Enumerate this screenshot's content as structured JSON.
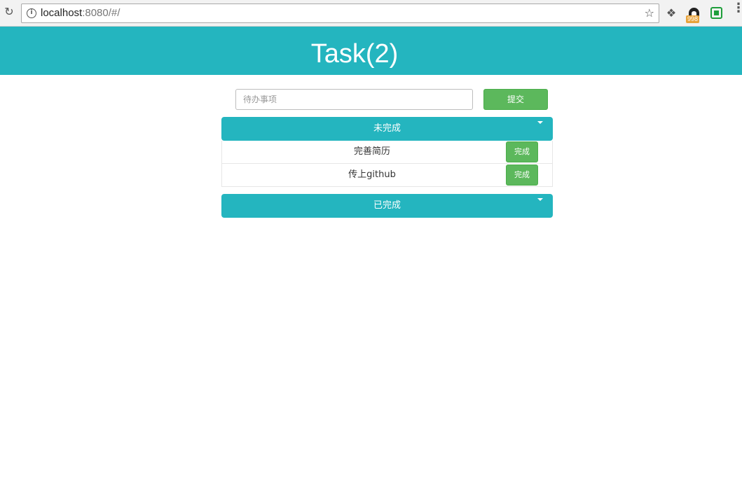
{
  "browser": {
    "url_host": "localhost",
    "url_rest": ":8080/#/",
    "extension_badge": "998"
  },
  "header": {
    "title": "Task(2)"
  },
  "form": {
    "input_placeholder": "待办事项",
    "input_value": "",
    "submit_label": "提交"
  },
  "pending": {
    "title": "未完成",
    "items": [
      {
        "text": "完善简历",
        "action": "完成"
      },
      {
        "text": "传上github",
        "action": "完成"
      }
    ]
  },
  "completed": {
    "title": "已完成"
  },
  "colors": {
    "teal": "#24b5bf",
    "green": "#5cb85c"
  }
}
